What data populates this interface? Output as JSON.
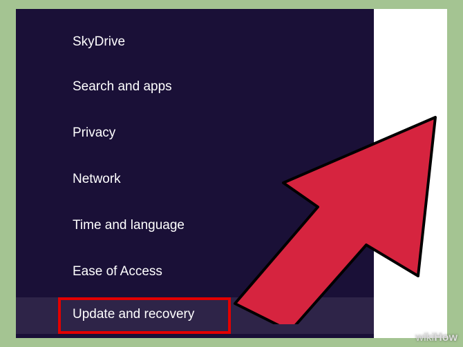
{
  "settings": {
    "items": [
      {
        "label": "SkyDrive"
      },
      {
        "label": "Search and apps"
      },
      {
        "label": "Privacy"
      },
      {
        "label": "Network"
      },
      {
        "label": "Time and language"
      },
      {
        "label": "Ease of Access"
      },
      {
        "label": "Update and recovery"
      }
    ]
  },
  "watermark": {
    "part1": "wiki",
    "part2": "How"
  }
}
